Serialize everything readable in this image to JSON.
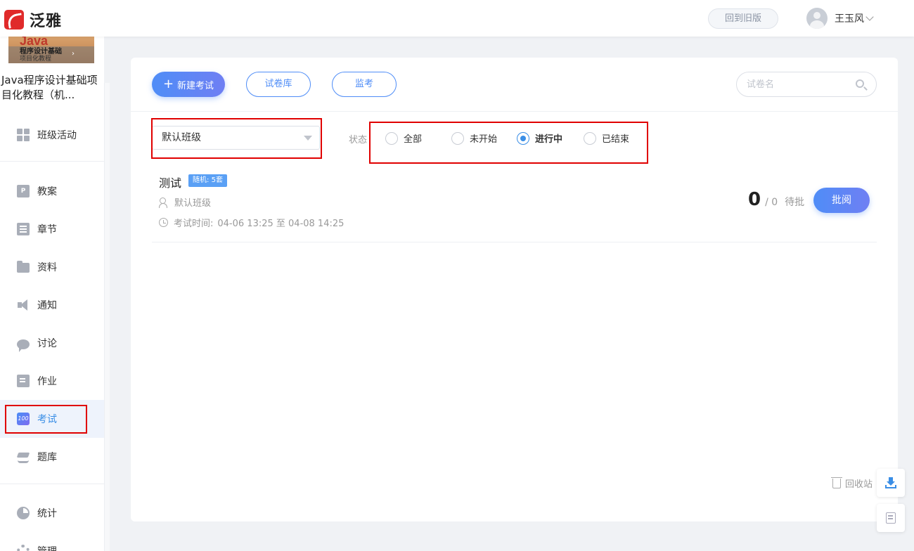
{
  "header": {
    "logo_text": "泛雅",
    "back_old_label": "回到旧版",
    "user_name": "王玉风"
  },
  "sidebar": {
    "cover_title": "Java",
    "cover_subtitle": "程序设计基础",
    "cover_subtitle2": "项目化教程",
    "course_title": "Java程序设计基础项目化教程（机...",
    "items": [
      {
        "label": "班级活动",
        "icon": "grid-icon"
      },
      {
        "label": "教案",
        "icon": "doc-icon"
      },
      {
        "label": "章节",
        "icon": "list-icon"
      },
      {
        "label": "资料",
        "icon": "folder-icon"
      },
      {
        "label": "通知",
        "icon": "speaker-icon"
      },
      {
        "label": "讨论",
        "icon": "chat-icon"
      },
      {
        "label": "作业",
        "icon": "edit-icon"
      },
      {
        "label": "考试",
        "icon": "exam-icon",
        "active": true
      },
      {
        "label": "题库",
        "icon": "layers-icon"
      },
      {
        "label": "统计",
        "icon": "pie-icon"
      },
      {
        "label": "管理",
        "icon": "gear-icon"
      }
    ]
  },
  "toolbar": {
    "new_exam_label": "新建考试",
    "paper_bank_label": "试卷库",
    "proctor_label": "监考",
    "search_placeholder": "试卷名"
  },
  "filter": {
    "class_select_value": "默认班级",
    "status_label": "状态",
    "status_options": [
      "全部",
      "未开始",
      "进行中",
      "已结束"
    ],
    "status_selected": "进行中"
  },
  "exams": [
    {
      "title": "测试",
      "badge": "随机: 5套",
      "class_name": "默认班级",
      "time_label": "考试时间:",
      "time_range": "04-06 13:25 至 04-08 14:25",
      "pending_count": "0",
      "total_count": "/ 0",
      "pending_label": "待批",
      "review_label": "批阅"
    }
  ],
  "footer": {
    "recycle_label": "回收站"
  },
  "colors": {
    "accent": "#4f8df7",
    "active_nav_bg": "#eef3fc",
    "highlight_box": "#e00000"
  }
}
